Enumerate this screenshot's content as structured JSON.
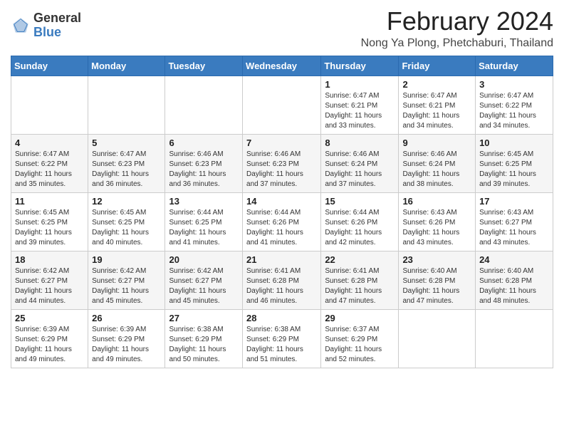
{
  "logo": {
    "general": "General",
    "blue": "Blue"
  },
  "title": "February 2024",
  "subtitle": "Nong Ya Plong, Phetchaburi, Thailand",
  "days_of_week": [
    "Sunday",
    "Monday",
    "Tuesday",
    "Wednesday",
    "Thursday",
    "Friday",
    "Saturday"
  ],
  "weeks": [
    [
      {
        "day": "",
        "info": ""
      },
      {
        "day": "",
        "info": ""
      },
      {
        "day": "",
        "info": ""
      },
      {
        "day": "",
        "info": ""
      },
      {
        "day": "1",
        "info": "Sunrise: 6:47 AM\nSunset: 6:21 PM\nDaylight: 11 hours\nand 33 minutes."
      },
      {
        "day": "2",
        "info": "Sunrise: 6:47 AM\nSunset: 6:21 PM\nDaylight: 11 hours\nand 34 minutes."
      },
      {
        "day": "3",
        "info": "Sunrise: 6:47 AM\nSunset: 6:22 PM\nDaylight: 11 hours\nand 34 minutes."
      }
    ],
    [
      {
        "day": "4",
        "info": "Sunrise: 6:47 AM\nSunset: 6:22 PM\nDaylight: 11 hours\nand 35 minutes."
      },
      {
        "day": "5",
        "info": "Sunrise: 6:47 AM\nSunset: 6:23 PM\nDaylight: 11 hours\nand 36 minutes."
      },
      {
        "day": "6",
        "info": "Sunrise: 6:46 AM\nSunset: 6:23 PM\nDaylight: 11 hours\nand 36 minutes."
      },
      {
        "day": "7",
        "info": "Sunrise: 6:46 AM\nSunset: 6:23 PM\nDaylight: 11 hours\nand 37 minutes."
      },
      {
        "day": "8",
        "info": "Sunrise: 6:46 AM\nSunset: 6:24 PM\nDaylight: 11 hours\nand 37 minutes."
      },
      {
        "day": "9",
        "info": "Sunrise: 6:46 AM\nSunset: 6:24 PM\nDaylight: 11 hours\nand 38 minutes."
      },
      {
        "day": "10",
        "info": "Sunrise: 6:45 AM\nSunset: 6:25 PM\nDaylight: 11 hours\nand 39 minutes."
      }
    ],
    [
      {
        "day": "11",
        "info": "Sunrise: 6:45 AM\nSunset: 6:25 PM\nDaylight: 11 hours\nand 39 minutes."
      },
      {
        "day": "12",
        "info": "Sunrise: 6:45 AM\nSunset: 6:25 PM\nDaylight: 11 hours\nand 40 minutes."
      },
      {
        "day": "13",
        "info": "Sunrise: 6:44 AM\nSunset: 6:25 PM\nDaylight: 11 hours\nand 41 minutes."
      },
      {
        "day": "14",
        "info": "Sunrise: 6:44 AM\nSunset: 6:26 PM\nDaylight: 11 hours\nand 41 minutes."
      },
      {
        "day": "15",
        "info": "Sunrise: 6:44 AM\nSunset: 6:26 PM\nDaylight: 11 hours\nand 42 minutes."
      },
      {
        "day": "16",
        "info": "Sunrise: 6:43 AM\nSunset: 6:26 PM\nDaylight: 11 hours\nand 43 minutes."
      },
      {
        "day": "17",
        "info": "Sunrise: 6:43 AM\nSunset: 6:27 PM\nDaylight: 11 hours\nand 43 minutes."
      }
    ],
    [
      {
        "day": "18",
        "info": "Sunrise: 6:42 AM\nSunset: 6:27 PM\nDaylight: 11 hours\nand 44 minutes."
      },
      {
        "day": "19",
        "info": "Sunrise: 6:42 AM\nSunset: 6:27 PM\nDaylight: 11 hours\nand 45 minutes."
      },
      {
        "day": "20",
        "info": "Sunrise: 6:42 AM\nSunset: 6:27 PM\nDaylight: 11 hours\nand 45 minutes."
      },
      {
        "day": "21",
        "info": "Sunrise: 6:41 AM\nSunset: 6:28 PM\nDaylight: 11 hours\nand 46 minutes."
      },
      {
        "day": "22",
        "info": "Sunrise: 6:41 AM\nSunset: 6:28 PM\nDaylight: 11 hours\nand 47 minutes."
      },
      {
        "day": "23",
        "info": "Sunrise: 6:40 AM\nSunset: 6:28 PM\nDaylight: 11 hours\nand 47 minutes."
      },
      {
        "day": "24",
        "info": "Sunrise: 6:40 AM\nSunset: 6:28 PM\nDaylight: 11 hours\nand 48 minutes."
      }
    ],
    [
      {
        "day": "25",
        "info": "Sunrise: 6:39 AM\nSunset: 6:29 PM\nDaylight: 11 hours\nand 49 minutes."
      },
      {
        "day": "26",
        "info": "Sunrise: 6:39 AM\nSunset: 6:29 PM\nDaylight: 11 hours\nand 49 minutes."
      },
      {
        "day": "27",
        "info": "Sunrise: 6:38 AM\nSunset: 6:29 PM\nDaylight: 11 hours\nand 50 minutes."
      },
      {
        "day": "28",
        "info": "Sunrise: 6:38 AM\nSunset: 6:29 PM\nDaylight: 11 hours\nand 51 minutes."
      },
      {
        "day": "29",
        "info": "Sunrise: 6:37 AM\nSunset: 6:29 PM\nDaylight: 11 hours\nand 52 minutes."
      },
      {
        "day": "",
        "info": ""
      },
      {
        "day": "",
        "info": ""
      }
    ]
  ]
}
